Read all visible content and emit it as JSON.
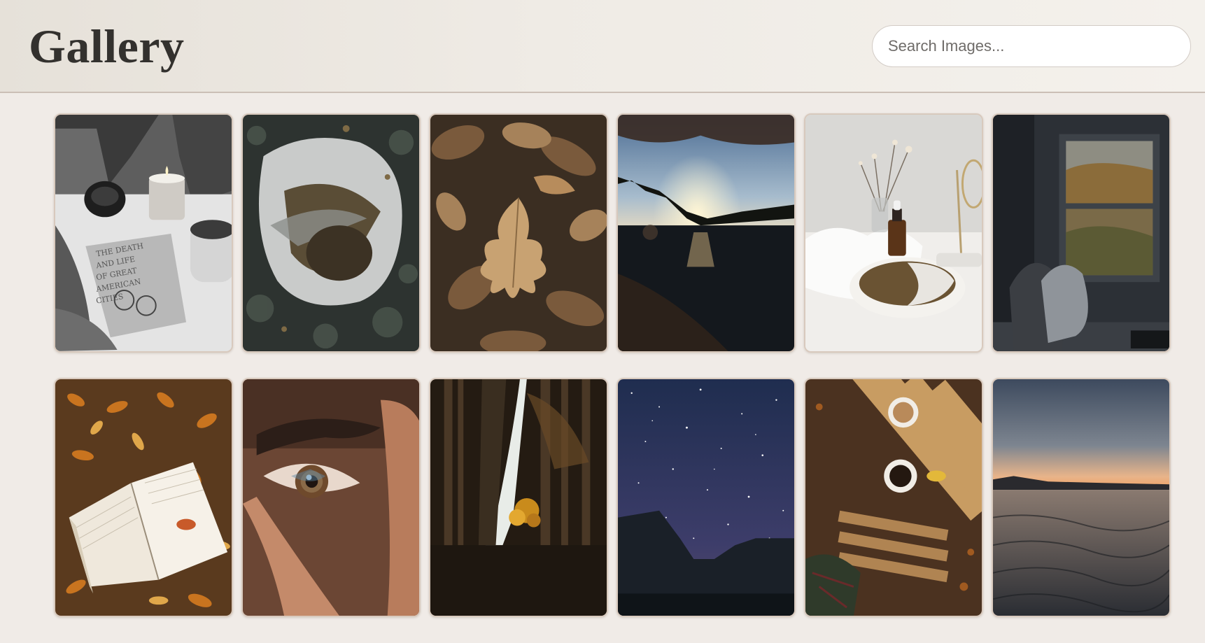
{
  "header": {
    "title": "Gallery",
    "search_placeholder": "Search Images..."
  },
  "gallery": {
    "images": [
      {
        "subject": "candle-book-still-life"
      },
      {
        "subject": "puddle-reflection"
      },
      {
        "subject": "autumn-oak-leaves"
      },
      {
        "subject": "lake-sunset"
      },
      {
        "subject": "serum-bottle-bowl"
      },
      {
        "subject": "window-interior"
      },
      {
        "subject": "book-in-leaves"
      },
      {
        "subject": "eye-closeup"
      },
      {
        "subject": "forest-path"
      },
      {
        "subject": "starry-night"
      },
      {
        "subject": "coffee-table-leaves"
      },
      {
        "subject": "beach-dusk"
      }
    ]
  }
}
